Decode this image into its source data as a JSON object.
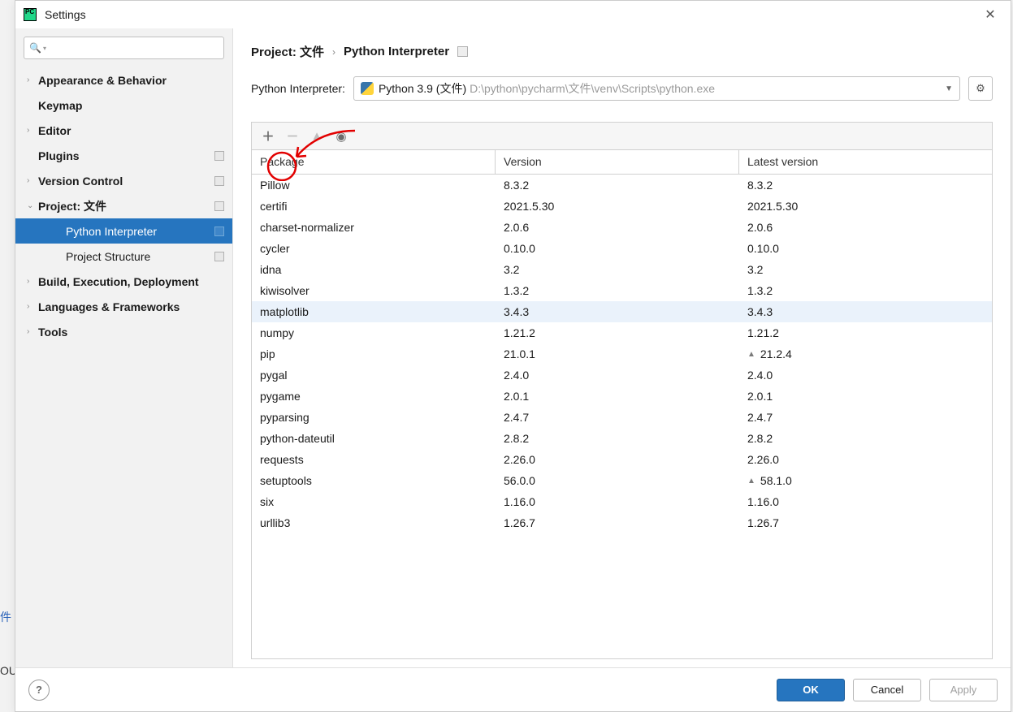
{
  "window": {
    "title": "Settings"
  },
  "search": {
    "placeholder": ""
  },
  "sidebar": {
    "items": [
      {
        "label": "Appearance & Behavior",
        "arrow": "›",
        "bold": true
      },
      {
        "label": "Keymap",
        "arrow": "",
        "bold": true
      },
      {
        "label": "Editor",
        "arrow": "›",
        "bold": true
      },
      {
        "label": "Plugins",
        "arrow": "",
        "bold": true,
        "badge": true
      },
      {
        "label": "Version Control",
        "arrow": "›",
        "bold": true,
        "badge": true
      },
      {
        "label": "Project: 文件",
        "arrow": "⌄",
        "bold": true,
        "badge": true
      },
      {
        "label": "Python Interpreter",
        "arrow": "",
        "child": true,
        "badge": true,
        "selected": true
      },
      {
        "label": "Project Structure",
        "arrow": "",
        "child": true,
        "badge": true
      },
      {
        "label": "Build, Execution, Deployment",
        "arrow": "›",
        "bold": true
      },
      {
        "label": "Languages & Frameworks",
        "arrow": "›",
        "bold": true
      },
      {
        "label": "Tools",
        "arrow": "›",
        "bold": true
      }
    ]
  },
  "breadcrumb": {
    "root": "Project: 文件",
    "sep": "›",
    "page": "Python Interpreter"
  },
  "interpreter": {
    "label": "Python Interpreter:",
    "name": "Python 3.9 (文件)",
    "path": "D:\\python\\pycharm\\文件\\venv\\Scripts\\python.exe"
  },
  "columns": {
    "package": "Package",
    "version": "Version",
    "latest": "Latest version"
  },
  "packages": [
    {
      "name": "Pillow",
      "version": "8.3.2",
      "latest": "8.3.2"
    },
    {
      "name": "certifi",
      "version": "2021.5.30",
      "latest": "2021.5.30"
    },
    {
      "name": "charset-normalizer",
      "version": "2.0.6",
      "latest": "2.0.6"
    },
    {
      "name": "cycler",
      "version": "0.10.0",
      "latest": "0.10.0"
    },
    {
      "name": "idna",
      "version": "3.2",
      "latest": "3.2"
    },
    {
      "name": "kiwisolver",
      "version": "1.3.2",
      "latest": "1.3.2"
    },
    {
      "name": "matplotlib",
      "version": "3.4.3",
      "latest": "3.4.3",
      "selected": true
    },
    {
      "name": "numpy",
      "version": "1.21.2",
      "latest": "1.21.2"
    },
    {
      "name": "pip",
      "version": "21.0.1",
      "latest": "21.2.4",
      "upgradable": true
    },
    {
      "name": "pygal",
      "version": "2.4.0",
      "latest": "2.4.0"
    },
    {
      "name": "pygame",
      "version": "2.0.1",
      "latest": "2.0.1"
    },
    {
      "name": "pyparsing",
      "version": "2.4.7",
      "latest": "2.4.7"
    },
    {
      "name": "python-dateutil",
      "version": "2.8.2",
      "latest": "2.8.2"
    },
    {
      "name": "requests",
      "version": "2.26.0",
      "latest": "2.26.0"
    },
    {
      "name": "setuptools",
      "version": "56.0.0",
      "latest": "58.1.0",
      "upgradable": true
    },
    {
      "name": "six",
      "version": "1.16.0",
      "latest": "1.16.0"
    },
    {
      "name": "urllib3",
      "version": "1.26.7",
      "latest": "1.26.7"
    }
  ],
  "buttons": {
    "ok": "OK",
    "cancel": "Cancel",
    "apply": "Apply"
  },
  "background": {
    "text1": "件",
    "text2": "OU"
  }
}
